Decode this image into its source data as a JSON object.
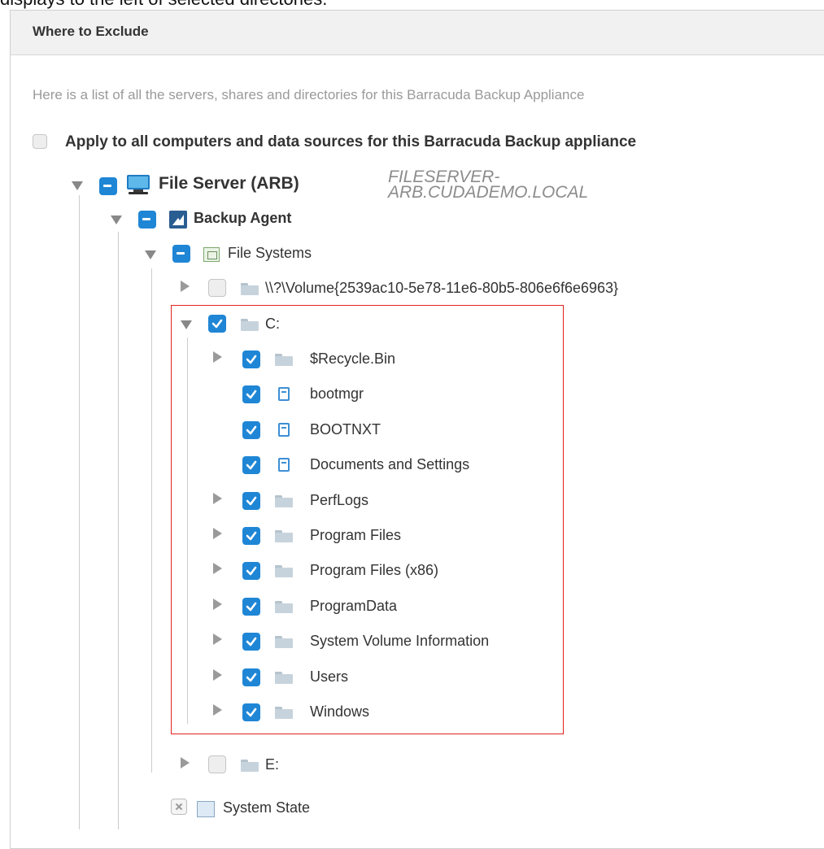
{
  "top_text": "displays to the left of selected directories.",
  "panel": {
    "title": "Where to Exclude",
    "intro": "Here is a list of all the servers, shares and directories for this Barracuda Backup Appliance",
    "apply_all_label": "Apply to all computers and data sources for this Barracuda Backup appliance"
  },
  "tree": {
    "server": {
      "label": "File Server (ARB)",
      "hostname": "FILESERVER-ARB.CUDADEMO.LOCAL"
    },
    "agent": {
      "label": "Backup Agent"
    },
    "file_systems": {
      "label": "File Systems"
    },
    "volume": {
      "label": "\\\\?\\Volume{2539ac10-5e78-11e6-80b5-806e6f6e6963}"
    },
    "drive_c": {
      "label": "C:",
      "children": [
        {
          "label": "$Recycle.Bin",
          "kind": "folder"
        },
        {
          "label": "bootmgr",
          "kind": "file"
        },
        {
          "label": "BOOTNXT",
          "kind": "file"
        },
        {
          "label": "Documents and Settings",
          "kind": "file"
        },
        {
          "label": "PerfLogs",
          "kind": "folder"
        },
        {
          "label": "Program Files",
          "kind": "folder"
        },
        {
          "label": "Program Files (x86)",
          "kind": "folder"
        },
        {
          "label": "ProgramData",
          "kind": "folder"
        },
        {
          "label": "System Volume Information",
          "kind": "folder"
        },
        {
          "label": "Users",
          "kind": "folder"
        },
        {
          "label": "Windows",
          "kind": "folder"
        }
      ]
    },
    "drive_e": {
      "label": "E:"
    },
    "system_state": {
      "label": "System State"
    }
  },
  "colors": {
    "accent": "#1f86d6",
    "highlight": "#e2221e"
  },
  "icons": [
    "monitor-icon",
    "backup-agent-icon",
    "file-systems-icon",
    "folder-icon",
    "file-icon",
    "system-state-icon",
    "expand-arrow-icon",
    "collapse-arrow-icon"
  ]
}
